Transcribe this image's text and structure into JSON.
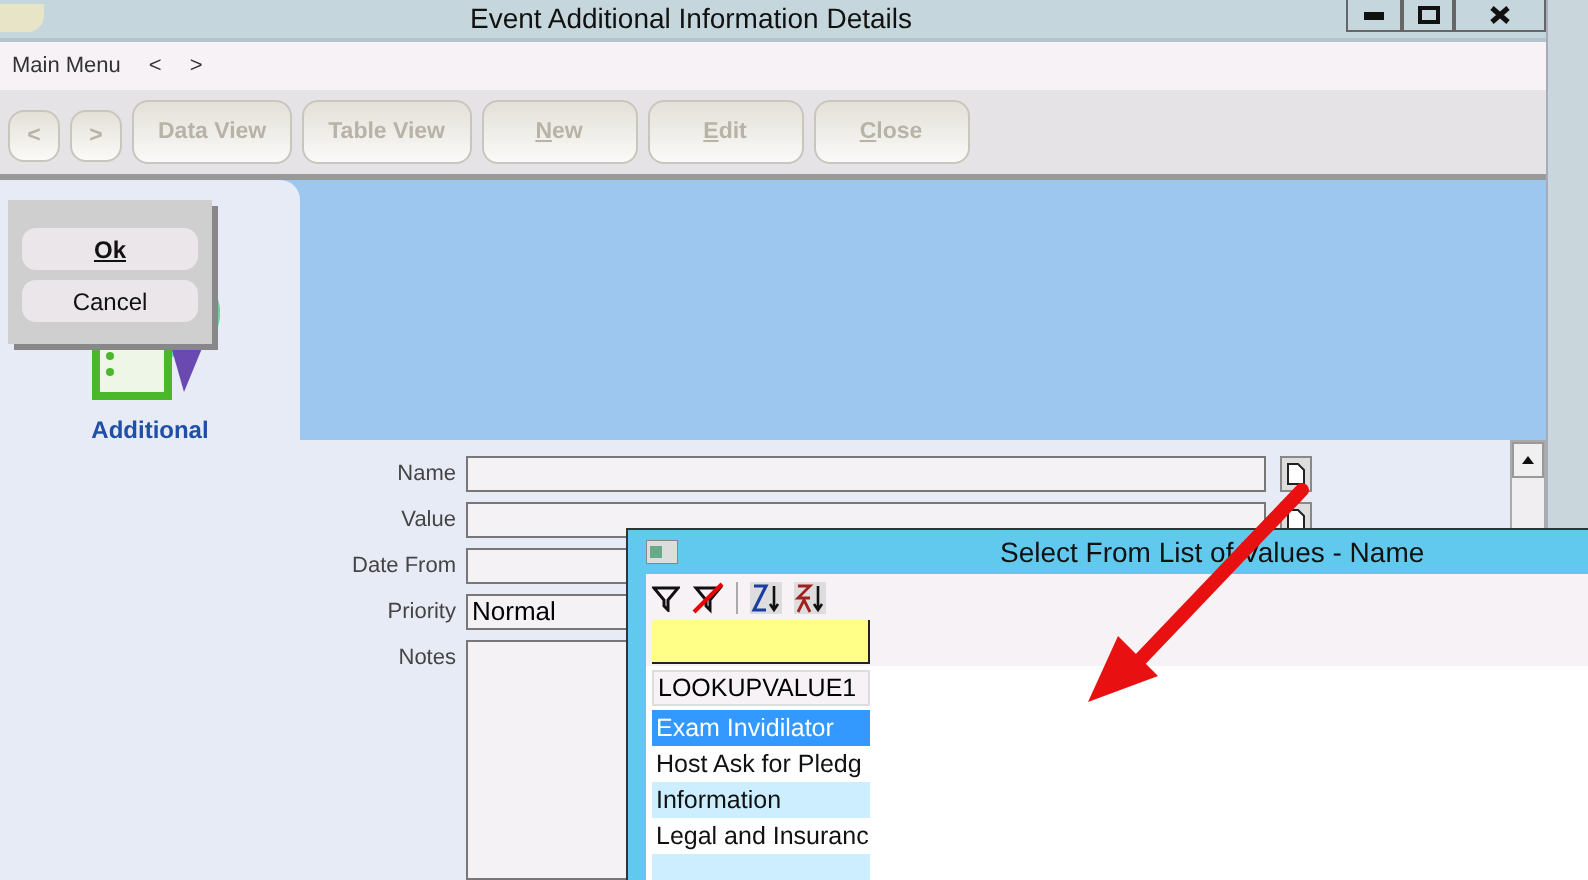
{
  "window": {
    "title": "Event Additional Information Details"
  },
  "menu_bar": {
    "items": [
      "Main Menu",
      "<",
      ">"
    ]
  },
  "toolbar": {
    "buttons": [
      {
        "label": "<",
        "disabled": true
      },
      {
        "label": ">",
        "disabled": true
      },
      {
        "label": "Data View",
        "disabled": true
      },
      {
        "label": "Table View",
        "disabled": true
      },
      {
        "label": "**N**ew",
        "disabled": true
      },
      {
        "label": "**E**dit",
        "disabled": true
      },
      {
        "label": "**C**lose",
        "disabled": true
      }
    ]
  },
  "side_tab": {
    "label": "Additional",
    "selected": true
  },
  "popup": {
    "buttons": [
      "Ok",
      "Cancel"
    ]
  },
  "form": {
    "fields": [
      {
        "label": "Name",
        "kind": "lookup"
      },
      {
        "label": "Value",
        "kind": "lookup"
      },
      {
        "label": "Date From",
        "kind": "text"
      },
      {
        "label": "Priority",
        "value": "Normal",
        "kind": "text"
      },
      {
        "label": "Notes",
        "kind": "area"
      }
    ]
  },
  "dialog": {
    "title": "Select From List of Values - Name",
    "column": "LOOKUPVALUE1",
    "rows": [
      {
        "text": "Exam Invidilator",
        "selected": true
      },
      {
        "text": "Host Ask for Pledg",
        "selected": false
      },
      {
        "text": "Information",
        "selected": false
      },
      {
        "text": "Legal and Insuranc",
        "selected": false
      },
      {
        "selected": false
      }
    ]
  }
}
